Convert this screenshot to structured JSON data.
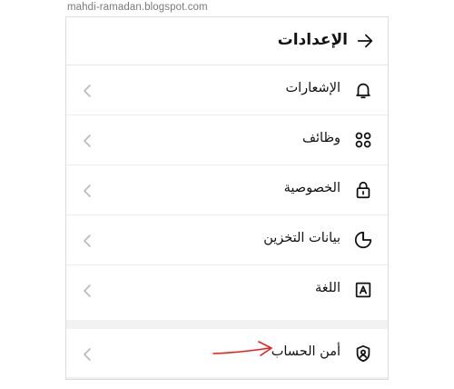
{
  "watermark": "mahdi-ramadan.blogspot.com",
  "header": {
    "title": "الإعدادات",
    "back_icon": "arrow-right-icon"
  },
  "items": [
    {
      "label": "الإشعارات",
      "icon": "bell-icon"
    },
    {
      "label": "وظائف",
      "icon": "four-circles-grid-icon"
    },
    {
      "label": "الخصوصية",
      "icon": "lock-icon"
    },
    {
      "label": "بيانات التخزين",
      "icon": "pie-chart-icon"
    },
    {
      "label": "اللغة",
      "icon": "letter-a-frame-icon"
    },
    {
      "label": "أمن الحساب",
      "icon": "shield-user-icon"
    }
  ],
  "colors": {
    "annotation_arrow": "#e8221d",
    "chevron": "#b9b9b9",
    "divider": "#ececec"
  }
}
